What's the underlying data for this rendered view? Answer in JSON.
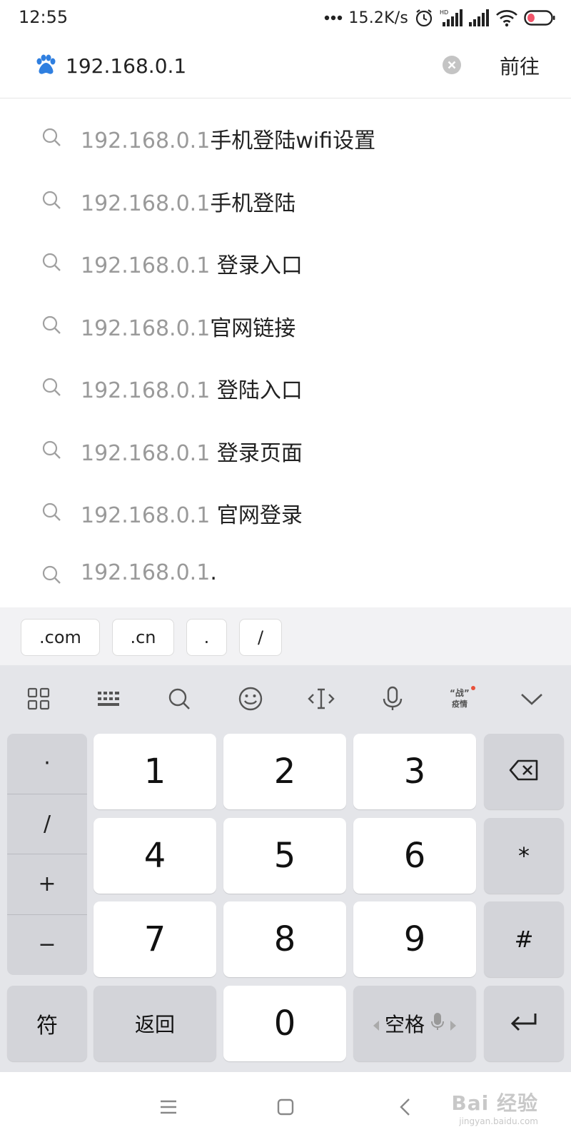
{
  "status_bar": {
    "time": "12:55",
    "net_speed": "15.2K/s"
  },
  "search": {
    "value": "192.168.0.1",
    "go_label": "前往"
  },
  "suggestions": [
    {
      "prefix": "192.168.0.1",
      "suffix": "手机登陆wifi设置"
    },
    {
      "prefix": "192.168.0.1",
      "suffix": "手机登陆"
    },
    {
      "prefix": "192.168.0.1",
      "suffix": " 登录入口"
    },
    {
      "prefix": "192.168.0.1",
      "suffix": "官网链接"
    },
    {
      "prefix": "192.168.0.1",
      "suffix": " 登陆入口"
    },
    {
      "prefix": "192.168.0.1",
      "suffix": " 登录页面"
    },
    {
      "prefix": "192.168.0.1",
      "suffix": " 官网登录"
    },
    {
      "prefix": "192.168.0.1",
      "suffix": "."
    }
  ],
  "quick_buttons": [
    ".com",
    ".cn",
    ".",
    "/"
  ],
  "keyboard": {
    "toolbar_icons": [
      "grid-icon",
      "keyboard-icon",
      "search-icon",
      "emoji-icon",
      "cursor-icon",
      "microphone-icon",
      "epidemic-icon",
      "chevron-down-icon"
    ],
    "epidemic_label_top": "“战”",
    "epidemic_label_bottom": "疫情",
    "symbols": [
      "·",
      "/",
      "+",
      "−"
    ],
    "digits": [
      "1",
      "2",
      "3",
      "4",
      "5",
      "6",
      "7",
      "8",
      "9",
      "0"
    ],
    "right_keys": [
      "backspace-icon",
      "*",
      "#",
      "enter-icon"
    ],
    "fu_label": "符",
    "back_label": "返回",
    "space_label": "空格"
  },
  "nav_bar": {
    "watermark_main": "Bai 经验",
    "watermark_sub": "jingyan.baidu.com"
  }
}
